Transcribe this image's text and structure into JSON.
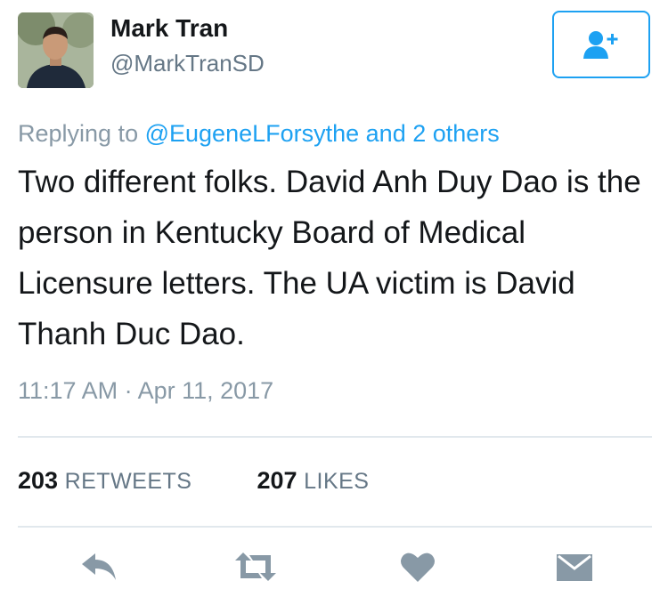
{
  "user": {
    "name": "Mark Tran",
    "handle": "@MarkTranSD",
    "avatar_icon": "profile-photo"
  },
  "follow_button": {
    "icon": "add-user-icon",
    "color": "#1da1f2"
  },
  "replying": {
    "prefix": "Replying to",
    "mention": "@EugeneLForsythe and 2 others"
  },
  "tweet": {
    "text": "Two different folks. David Anh Duy Dao is the person in Kentucky Board of Medical Licensure letters. The UA victim is David Thanh Duc Dao."
  },
  "timestamp": "11:17 AM · Apr 11, 2017",
  "stats": {
    "retweets_count": "203",
    "retweets_label": "RETWEETS",
    "likes_count": "207",
    "likes_label": "LIKES"
  },
  "actions": [
    {
      "name": "reply-icon"
    },
    {
      "name": "retweet-icon"
    },
    {
      "name": "like-icon"
    },
    {
      "name": "message-icon"
    }
  ],
  "colors": {
    "accent": "#1da1f2",
    "secondary_text": "#8899a6",
    "action_icon": "#8899a6"
  }
}
